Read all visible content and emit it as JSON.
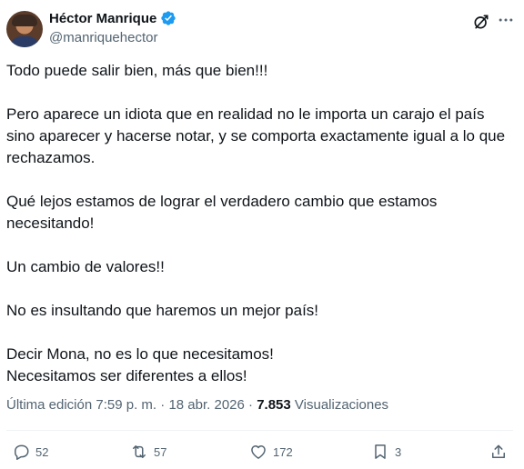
{
  "author": {
    "name": "Héctor Manrique",
    "handle": "@manriquehector"
  },
  "tweet": {
    "paragraphs": [
      "Todo puede salir bien, más que bien!!!",
      "Pero aparece un idiota que en realidad no le importa un carajo el país\nsino aparecer y hacerse notar, y se comporta exactamente igual a lo que\nrechazamos.",
      "Qué lejos estamos de lograr el verdadero cambio que estamos\nnecesitando!",
      "Un cambio de valores!!",
      "No es insultando que haremos un mejor país!",
      "Decir Mona, no es lo que necesitamos!\nNecesitamos ser diferentes a ellos!"
    ]
  },
  "meta": {
    "edited_label": "Última edición",
    "time": "7:59 p. m.",
    "separator": "·",
    "date": "18 abr. 2026",
    "views_count": "7.853",
    "views_label": "Visualizaciones"
  },
  "actions": {
    "replies": "52",
    "reposts": "57",
    "likes": "172",
    "bookmarks": "3"
  },
  "icons": {
    "verified": "verified-badge-icon",
    "grok": "grok-icon",
    "more": "more-icon",
    "reply": "reply-icon",
    "repost": "repost-icon",
    "like": "like-icon",
    "bookmark": "bookmark-icon",
    "share": "share-icon"
  },
  "colors": {
    "verified_blue": "#1d9bf0",
    "secondary_text": "#536471",
    "primary_text": "#0f1419",
    "divider": "#eff3f4"
  }
}
